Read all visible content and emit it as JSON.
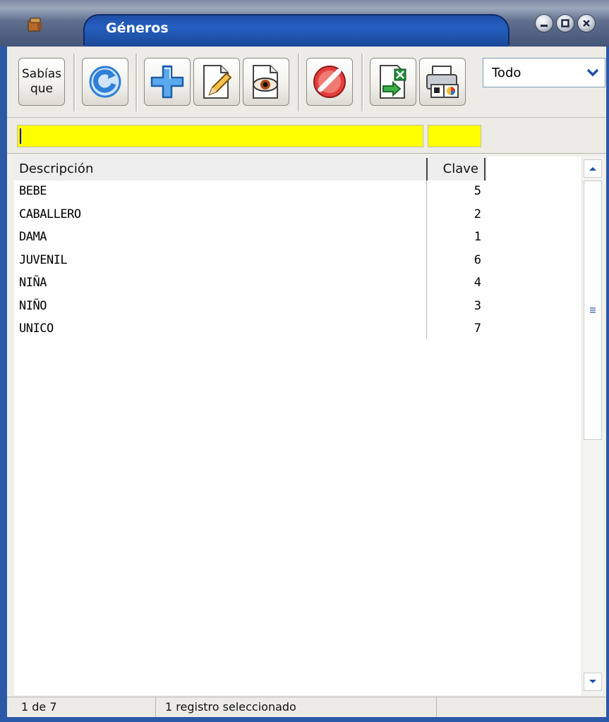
{
  "window": {
    "title": "Géneros",
    "icons": [
      "app-icon",
      "minimize-icon",
      "maximize-icon",
      "close-icon"
    ]
  },
  "toolbar": {
    "sabias_line1": "Sabías",
    "sabias_line2": "que",
    "buttons": [
      "refresh-icon",
      "add-icon",
      "edit-icon",
      "view-icon",
      "cancel-icon",
      "export-excel-icon",
      "print-icon"
    ],
    "filter_select": {
      "value": "Todo"
    }
  },
  "filters": {
    "description": "",
    "key": ""
  },
  "table": {
    "columns": [
      "Descripción",
      "Clave"
    ],
    "rows": [
      {
        "description": "BEBE",
        "key": "5"
      },
      {
        "description": "CABALLERO",
        "key": "2"
      },
      {
        "description": "DAMA",
        "key": "1"
      },
      {
        "description": "JUVENIL",
        "key": "6"
      },
      {
        "description": "NIÑA",
        "key": "4"
      },
      {
        "description": "NIÑO",
        "key": "3"
      },
      {
        "description": "UNICO",
        "key": "7"
      }
    ]
  },
  "status": {
    "position": "1 de 7",
    "selection": "1 registro seleccionado"
  },
  "colors": {
    "frame_blue": "#2a59a8",
    "filter_yellow": "#ffff00",
    "cancel_red": "#e53d3d",
    "refresh_blue": "#2e7fd6"
  }
}
